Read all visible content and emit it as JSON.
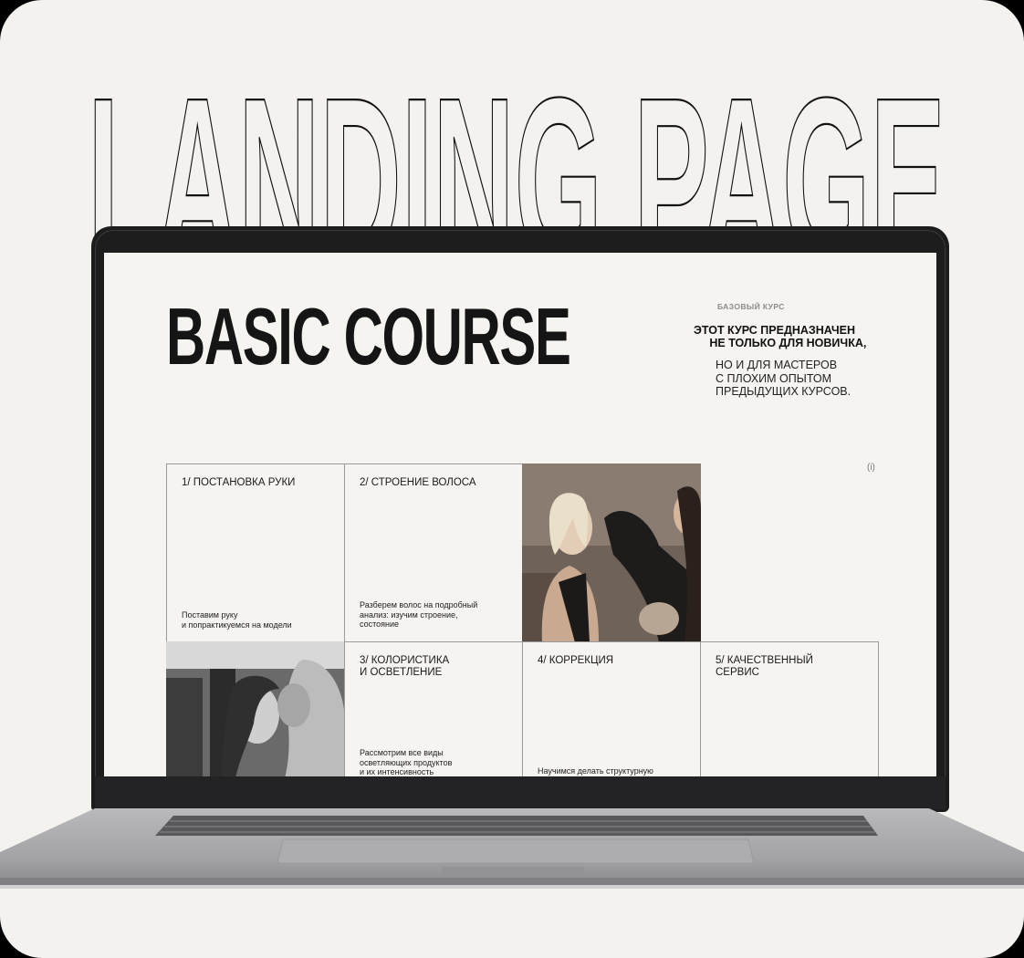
{
  "hero": {
    "text": "LANDING PAGE"
  },
  "screen": {
    "title": "BASIC COURSE",
    "kicker": "БАЗОВЫЙ КУРС",
    "intro_strong": "ЭТОТ КУРС ПРЕДНАЗНАЧЕН\n     НЕ ТОЛЬКО ДЛЯ НОВИЧКА,",
    "intro_normal": "НО И ДЛЯ МАСТЕРОВ\nС ПЛОХИМ ОПЫТОМ\nПРЕДЫДУЩИХ КУРСОВ.",
    "info_mark": "(i)"
  },
  "modules": [
    {
      "title": "1/ ПОСТАНОВКА РУКИ",
      "desc": "Поставим руку\nи попрактикуемся на модели"
    },
    {
      "title": "2/ СТРОЕНИЕ ВОЛОСА",
      "desc": "Разберем волос на подробный\nанализ: изучим строение,\nсостояние"
    },
    {
      "title": "3/ КОЛОРИСТИКА\nИ ОСВЕТЛЕНИЕ",
      "desc": "Рассмотрим все виды\nосветляющих продуктов\nи их интенсивность"
    },
    {
      "title": "4/ КОРРЕКЦИЯ",
      "desc": "Научимся делать структурную"
    },
    {
      "title": "5/ КАЧЕСТВЕННЫЙ\nСЕРВИС",
      "desc": ""
    }
  ]
}
